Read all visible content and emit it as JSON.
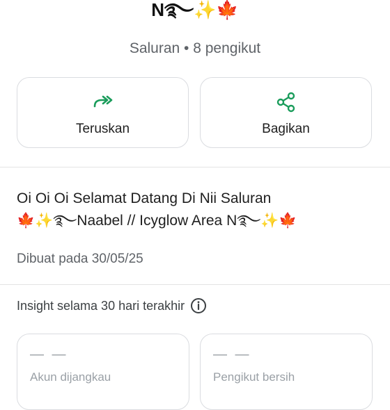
{
  "channel": {
    "name_display": "N࿐✨🍁",
    "subtitle": "Saluran • 8 pengikut"
  },
  "actions": {
    "forward_label": "Teruskan",
    "share_label": "Bagikan",
    "forward_icon": "forward-icon",
    "share_icon": "share-icon",
    "accent_color": "#1a9c5b"
  },
  "description": {
    "line1": "Oi Oi Oi Selamat Datang Di Nii Saluran",
    "line2": "🍁✨࿐Naabel // Icyglow Area N࿐✨🍁",
    "created": "Dibuat pada 30/05/25"
  },
  "insights": {
    "title": "Insight selama 30 hari terakhir",
    "info_icon": "info-icon",
    "metrics": [
      {
        "value": "— —",
        "label": "Akun dijangkau"
      },
      {
        "value": "— —",
        "label": "Pengikut bersih"
      }
    ]
  }
}
